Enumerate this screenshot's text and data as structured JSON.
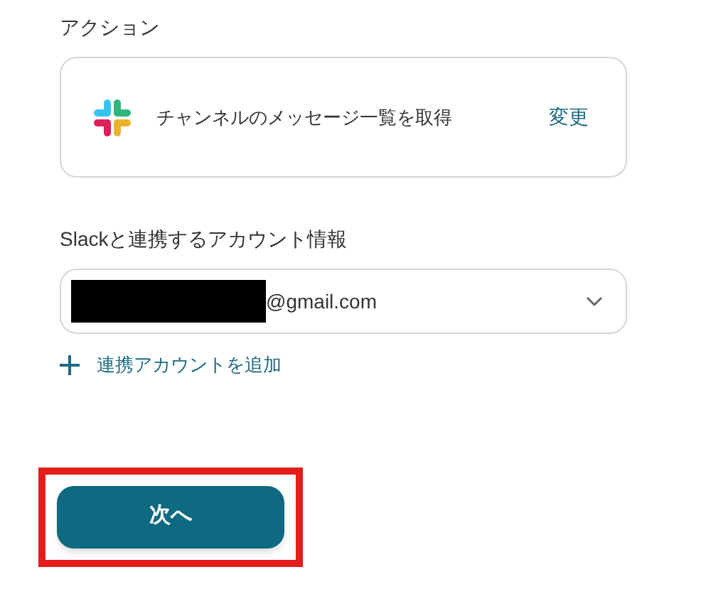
{
  "action": {
    "label": "アクション",
    "name": "チャンネルのメッセージ一覧を取得",
    "change": "変更"
  },
  "account": {
    "label": "Slackと連携するアカウント情報",
    "value": "@gmail.com",
    "redacted": true,
    "add": "連携アカウントを追加"
  },
  "next_button": {
    "label": "次へ",
    "highlighted": true
  }
}
